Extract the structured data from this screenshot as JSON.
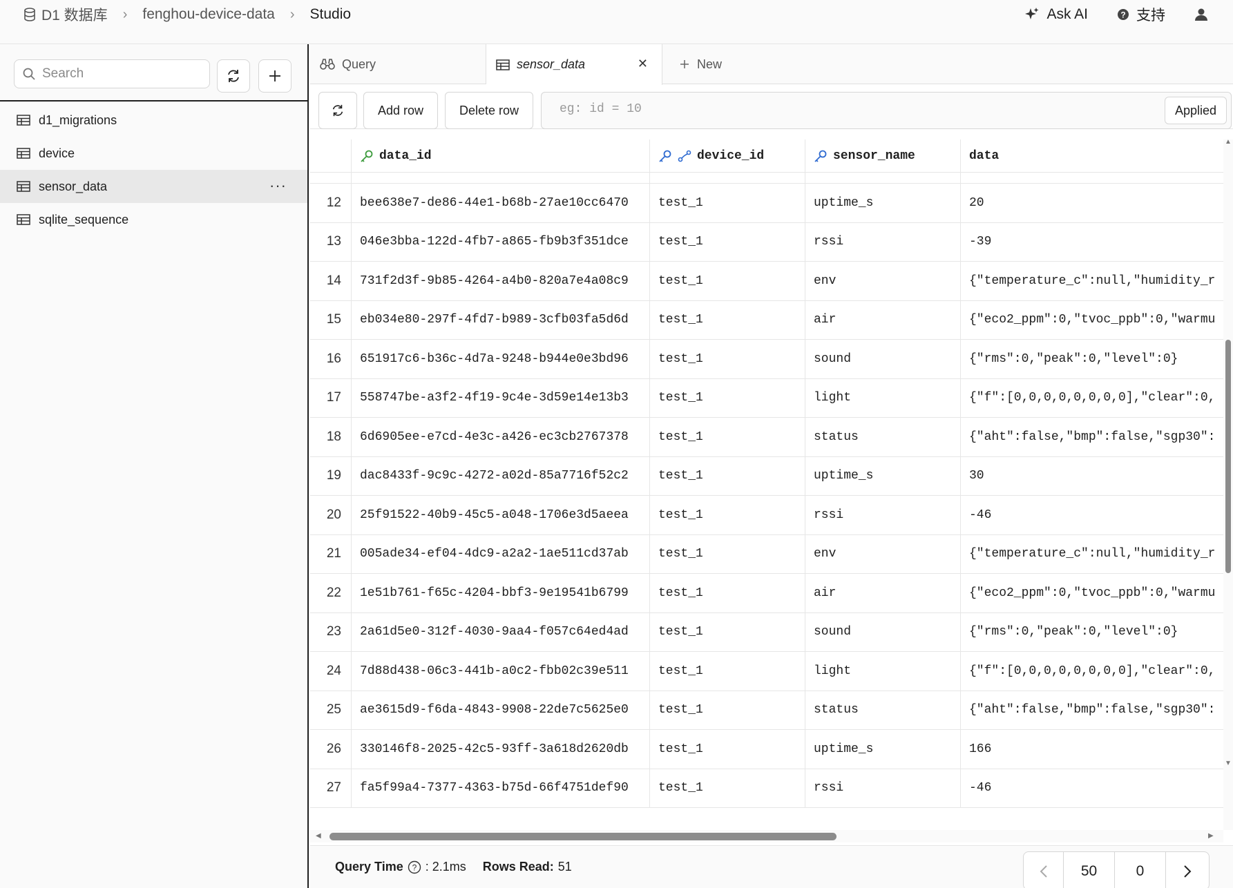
{
  "breadcrumb": {
    "items": [
      "D1 数据库",
      "fenghou-device-data",
      "Studio"
    ]
  },
  "header": {
    "ask_ai": "Ask AI",
    "support": "支持"
  },
  "sidebar": {
    "search_placeholder": "Search",
    "tables": [
      {
        "name": "d1_migrations"
      },
      {
        "name": "device"
      },
      {
        "name": "sensor_data"
      },
      {
        "name": "sqlite_sequence"
      }
    ],
    "more": "···"
  },
  "tabs": [
    {
      "label": "Query"
    },
    {
      "label": "sensor_data"
    },
    {
      "label": "New"
    }
  ],
  "toolbar": {
    "add_row": "Add row",
    "delete_row": "Delete row",
    "filter_placeholder": "eg: id = 10",
    "applied": "Applied"
  },
  "grid": {
    "columns": [
      "data_id",
      "device_id",
      "sensor_name",
      "data"
    ],
    "rows": [
      {
        "n": "12",
        "data_id": "bee638e7-de86-44e1-b68b-27ae10cc6470",
        "device_id": "test_1",
        "sensor_name": "uptime_s",
        "data": "20"
      },
      {
        "n": "13",
        "data_id": "046e3bba-122d-4fb7-a865-fb9b3f351dce",
        "device_id": "test_1",
        "sensor_name": "rssi",
        "data": "-39"
      },
      {
        "n": "14",
        "data_id": "731f2d3f-9b85-4264-a4b0-820a7e4a08c9",
        "device_id": "test_1",
        "sensor_name": "env",
        "data": "{\"temperature_c\":null,\"humidity_r"
      },
      {
        "n": "15",
        "data_id": "eb034e80-297f-4fd7-b989-3cfb03fa5d6d",
        "device_id": "test_1",
        "sensor_name": "air",
        "data": "{\"eco2_ppm\":0,\"tvoc_ppb\":0,\"warmu"
      },
      {
        "n": "16",
        "data_id": "651917c6-b36c-4d7a-9248-b944e0e3bd96",
        "device_id": "test_1",
        "sensor_name": "sound",
        "data": "{\"rms\":0,\"peak\":0,\"level\":0}"
      },
      {
        "n": "17",
        "data_id": "558747be-a3f2-4f19-9c4e-3d59e14e13b3",
        "device_id": "test_1",
        "sensor_name": "light",
        "data": "{\"f\":[0,0,0,0,0,0,0,0],\"clear\":0,"
      },
      {
        "n": "18",
        "data_id": "6d6905ee-e7cd-4e3c-a426-ec3cb2767378",
        "device_id": "test_1",
        "sensor_name": "status",
        "data": "{\"aht\":false,\"bmp\":false,\"sgp30\":"
      },
      {
        "n": "19",
        "data_id": "dac8433f-9c9c-4272-a02d-85a7716f52c2",
        "device_id": "test_1",
        "sensor_name": "uptime_s",
        "data": "30"
      },
      {
        "n": "20",
        "data_id": "25f91522-40b9-45c5-a048-1706e3d5aeea",
        "device_id": "test_1",
        "sensor_name": "rssi",
        "data": "-46"
      },
      {
        "n": "21",
        "data_id": "005ade34-ef04-4dc9-a2a2-1ae511cd37ab",
        "device_id": "test_1",
        "sensor_name": "env",
        "data": "{\"temperature_c\":null,\"humidity_r"
      },
      {
        "n": "22",
        "data_id": "1e51b761-f65c-4204-bbf3-9e19541b6799",
        "device_id": "test_1",
        "sensor_name": "air",
        "data": "{\"eco2_ppm\":0,\"tvoc_ppb\":0,\"warmu"
      },
      {
        "n": "23",
        "data_id": "2a61d5e0-312f-4030-9aa4-f057c64ed4ad",
        "device_id": "test_1",
        "sensor_name": "sound",
        "data": "{\"rms\":0,\"peak\":0,\"level\":0}"
      },
      {
        "n": "24",
        "data_id": "7d88d438-06c3-441b-a0c2-fbb02c39e511",
        "device_id": "test_1",
        "sensor_name": "light",
        "data": "{\"f\":[0,0,0,0,0,0,0,0],\"clear\":0,"
      },
      {
        "n": "25",
        "data_id": "ae3615d9-f6da-4843-9908-22de7c5625e0",
        "device_id": "test_1",
        "sensor_name": "status",
        "data": "{\"aht\":false,\"bmp\":false,\"sgp30\":"
      },
      {
        "n": "26",
        "data_id": "330146f8-2025-42c5-93ff-3a618d2620db",
        "device_id": "test_1",
        "sensor_name": "uptime_s",
        "data": "166"
      },
      {
        "n": "27",
        "data_id": "fa5f99a4-7377-4363-b75d-66f4751def90",
        "device_id": "test_1",
        "sensor_name": "rssi",
        "data": "-46"
      }
    ]
  },
  "footer": {
    "query_time_label": "Query Time",
    "query_time_value": ": 2.1ms",
    "rows_read_label": "Rows Read:",
    "rows_read_value": "51",
    "page_size": "50",
    "offset": "0"
  },
  "colors": {
    "key_green": "#3d9b3d",
    "key_blue": "#2f6bd1",
    "scroll_thumb": "#8c8c8c"
  }
}
